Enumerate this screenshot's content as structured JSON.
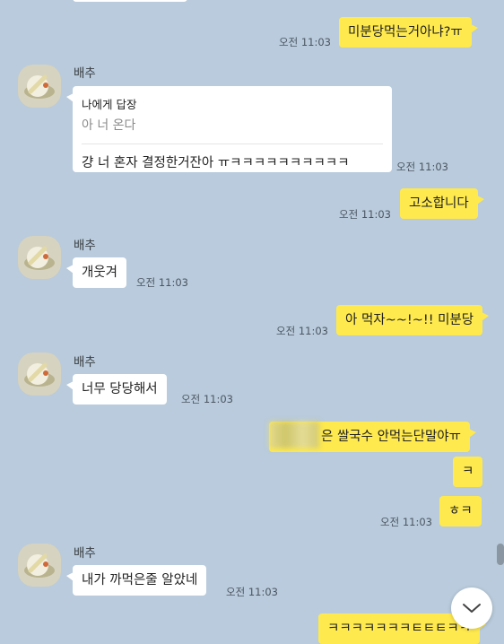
{
  "messages": {
    "m1": {
      "text": "미분당먹는거아냐?ㅠ",
      "time": "오전 11:03"
    },
    "m2": {
      "sender": "배추",
      "reply_label": "나에게 답장",
      "reply_quote": "아 너 온다",
      "text": "걍 너 혼자 결정한거잔아 ㅠㅋㅋㅋㅋㅋㅋㅋㅋㅋㅋ",
      "time": "오전 11:03"
    },
    "m3": {
      "text": "고소합니다",
      "time": "오전 11:03"
    },
    "m4": {
      "sender": "배추",
      "text": "개웃겨",
      "time": "오전 11:03"
    },
    "m5": {
      "text": "아 먹자~~!~!! 미분당",
      "time": "오전 11:03"
    },
    "m6": {
      "sender": "배추",
      "text": "너무 당당해서",
      "time": "오전 11:03"
    },
    "m7": {
      "text": "은 쌀국수 안먹는단말야ㅠ"
    },
    "m8": {
      "text": "ㅋ"
    },
    "m9": {
      "text": "ㅎㅋ",
      "time": "오전 11:03"
    },
    "m10": {
      "sender": "배추",
      "text": "내가 까먹은줄 알았네",
      "time": "오전 11:03"
    },
    "m11": {
      "text": "ㅋㅋㅋㅋㅋㅋㅋㅌㅌㅌㅋㅋ"
    }
  },
  "icons": {
    "avatar": "lemon-slice-avatar",
    "scroll_down": "chevron-down-icon"
  },
  "colors": {
    "background": "#b9cbdc",
    "my_bubble": "#fee94e",
    "their_bubble": "#ffffff"
  }
}
